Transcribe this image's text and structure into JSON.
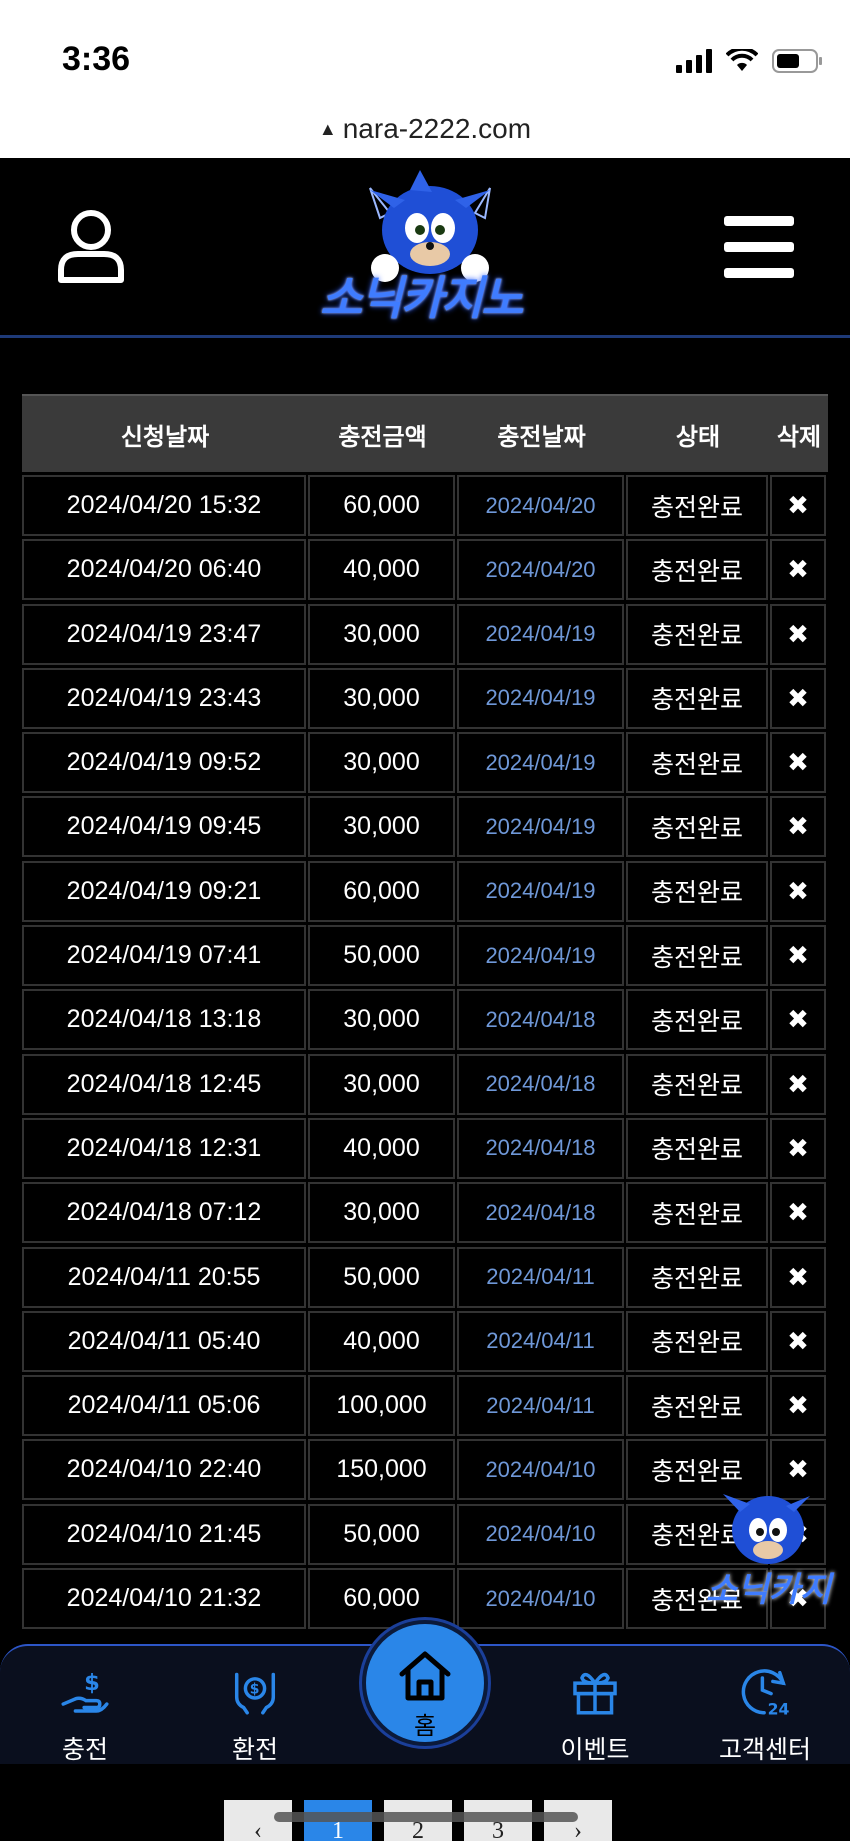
{
  "status": {
    "time": "3:36"
  },
  "browser": {
    "url": "nara-2222.com"
  },
  "site": {
    "logo_text": "소닉카지노"
  },
  "table": {
    "headers": [
      "신청날짜",
      "충전금액",
      "충전날짜",
      "상태",
      "삭제"
    ],
    "rows": [
      {
        "requested": "2024/04/20 15:32",
        "amount": "60,000",
        "charged": "2024/04/20",
        "status": "충전완료",
        "delete": "✖"
      },
      {
        "requested": "2024/04/20 06:40",
        "amount": "40,000",
        "charged": "2024/04/20",
        "status": "충전완료",
        "delete": "✖"
      },
      {
        "requested": "2024/04/19 23:47",
        "amount": "30,000",
        "charged": "2024/04/19",
        "status": "충전완료",
        "delete": "✖"
      },
      {
        "requested": "2024/04/19 23:43",
        "amount": "30,000",
        "charged": "2024/04/19",
        "status": "충전완료",
        "delete": "✖"
      },
      {
        "requested": "2024/04/19 09:52",
        "amount": "30,000",
        "charged": "2024/04/19",
        "status": "충전완료",
        "delete": "✖"
      },
      {
        "requested": "2024/04/19 09:45",
        "amount": "30,000",
        "charged": "2024/04/19",
        "status": "충전완료",
        "delete": "✖"
      },
      {
        "requested": "2024/04/19 09:21",
        "amount": "60,000",
        "charged": "2024/04/19",
        "status": "충전완료",
        "delete": "✖"
      },
      {
        "requested": "2024/04/19 07:41",
        "amount": "50,000",
        "charged": "2024/04/19",
        "status": "충전완료",
        "delete": "✖"
      },
      {
        "requested": "2024/04/18 13:18",
        "amount": "30,000",
        "charged": "2024/04/18",
        "status": "충전완료",
        "delete": "✖"
      },
      {
        "requested": "2024/04/18 12:45",
        "amount": "30,000",
        "charged": "2024/04/18",
        "status": "충전완료",
        "delete": "✖"
      },
      {
        "requested": "2024/04/18 12:31",
        "amount": "40,000",
        "charged": "2024/04/18",
        "status": "충전완료",
        "delete": "✖"
      },
      {
        "requested": "2024/04/18 07:12",
        "amount": "30,000",
        "charged": "2024/04/18",
        "status": "충전완료",
        "delete": "✖"
      },
      {
        "requested": "2024/04/11 20:55",
        "amount": "50,000",
        "charged": "2024/04/11",
        "status": "충전완료",
        "delete": "✖"
      },
      {
        "requested": "2024/04/11 05:40",
        "amount": "40,000",
        "charged": "2024/04/11",
        "status": "충전완료",
        "delete": "✖"
      },
      {
        "requested": "2024/04/11 05:06",
        "amount": "100,000",
        "charged": "2024/04/11",
        "status": "충전완료",
        "delete": "✖"
      },
      {
        "requested": "2024/04/10 22:40",
        "amount": "150,000",
        "charged": "2024/04/10",
        "status": "충전완료",
        "delete": "✖"
      },
      {
        "requested": "2024/04/10 21:45",
        "amount": "50,000",
        "charged": "2024/04/10",
        "status": "충전완료",
        "delete": "✖"
      },
      {
        "requested": "2024/04/10 21:32",
        "amount": "60,000",
        "charged": "2024/04/10",
        "status": "충전완료",
        "delete": "✖"
      }
    ]
  },
  "float_badge": {
    "text": "소닉카지"
  },
  "nav": {
    "deposit": "충전",
    "withdraw": "환전",
    "home": "홈",
    "event": "이벤트",
    "support": "고객센터"
  },
  "pagination": {
    "prev": "‹",
    "pages": [
      "1",
      "2",
      "3"
    ],
    "next": "›",
    "current": "1"
  },
  "colors": {
    "accent": "#2a86e8",
    "charged_date": "#6f98d8",
    "header_bg": "#3a3a3a"
  }
}
